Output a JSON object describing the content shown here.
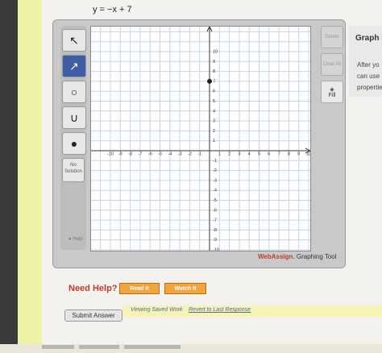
{
  "equation": "y = −x + 7",
  "tools": [
    {
      "name": "pointer",
      "glyph": "↖"
    },
    {
      "name": "line",
      "glyph": "↗"
    },
    {
      "name": "circle",
      "glyph": "○"
    },
    {
      "name": "parabola",
      "glyph": "∪"
    },
    {
      "name": "point",
      "glyph": "●"
    }
  ],
  "no_solution_label": "No Solution",
  "help_label": "Help",
  "right_buttons": {
    "delete_label": "Delete",
    "clear_label": "Clear All",
    "fill_label": "Fill"
  },
  "brand": {
    "name": "WebAssign",
    "suffix": ". Graphing Tool"
  },
  "side_card": {
    "title": "Graph L",
    "line1": "After yo",
    "line2": "can use",
    "line3": "propertie"
  },
  "need_help_label": "Need Help?",
  "read_it_label": "Read It",
  "watch_it_label": "Watch It",
  "submit_label": "Submit Answer",
  "saved_status": "Viewing Saved Work",
  "revert_label": "Revert to Last Response",
  "graph": {
    "x_ticks": [
      "-10",
      "-9",
      "-8",
      "-7",
      "-6",
      "-5",
      "-4",
      "-3",
      "-2",
      "-1",
      "1",
      "2",
      "3",
      "4",
      "5",
      "6",
      "7",
      "8",
      "9",
      "10"
    ],
    "y_ticks": [
      "10",
      "9",
      "8",
      "7",
      "6",
      "5",
      "4",
      "3",
      "2",
      "1",
      "-1",
      "-2",
      "-3",
      "-4",
      "-5",
      "-6",
      "-7",
      "-8",
      "-9",
      "-10"
    ],
    "xlim": [
      -10,
      10
    ],
    "ylim": [
      -10,
      10
    ],
    "point": {
      "x": 0,
      "y": 7
    },
    "colors": {
      "grid": "#c8d4e6",
      "axis": "#333333",
      "point": "#222222"
    }
  }
}
